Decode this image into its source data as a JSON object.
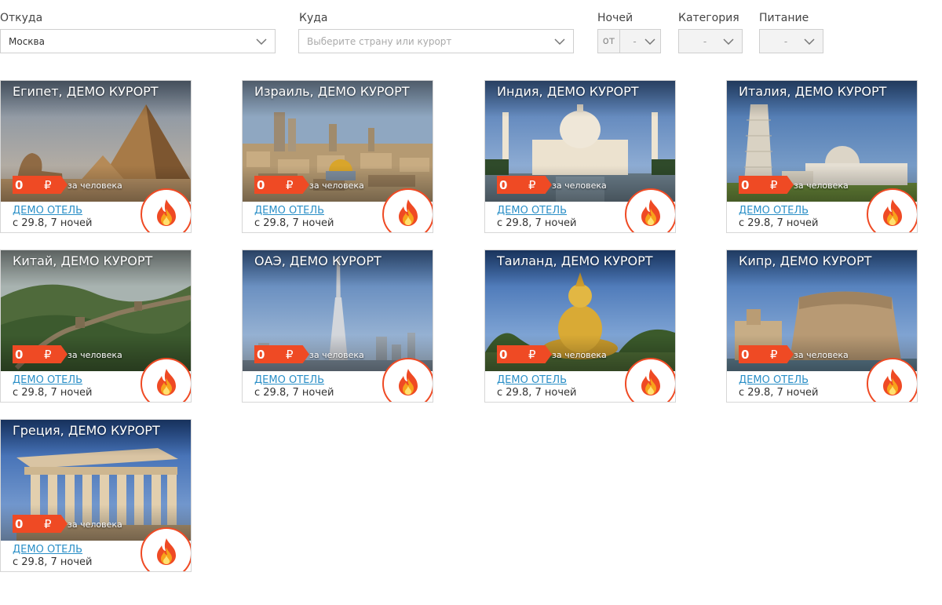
{
  "filters": {
    "from": {
      "label": "Откуда",
      "value": "Москва"
    },
    "to": {
      "label": "Куда",
      "placeholder": "Выберите страну или курорт"
    },
    "nights": {
      "label": "Ночей",
      "prefix": "от",
      "value": "-"
    },
    "category": {
      "label": "Категория",
      "value": "-"
    },
    "meal": {
      "label": "Питание",
      "value": "-"
    }
  },
  "colors": {
    "accent": "#ef4a24",
    "link": "#2a8fc7"
  },
  "tours": [
    {
      "title": "Египет, ДЕМО КУРОРТ",
      "price": "0",
      "currency": "₽",
      "per": "за человека",
      "hotel": "ДЕМО ОТЕЛЬ",
      "dates": "с 29.8, 7 ночей",
      "scene": "egypt",
      "hot_icon": "flame-icon"
    },
    {
      "title": "Израиль, ДЕМО КУРОРТ",
      "price": "0",
      "currency": "₽",
      "per": "за человека",
      "hotel": "ДЕМО ОТЕЛЬ",
      "dates": "с 29.8, 7 ночей",
      "scene": "israel",
      "hot_icon": "flame-icon"
    },
    {
      "title": "Индия, ДЕМО КУРОРТ",
      "price": "0",
      "currency": "₽",
      "per": "за человека",
      "hotel": "ДЕМО ОТЕЛЬ",
      "dates": "с 29.8, 7 ночей",
      "scene": "india",
      "hot_icon": "flame-icon"
    },
    {
      "title": "Италия, ДЕМО КУРОРТ",
      "price": "0",
      "currency": "₽",
      "per": "за человека",
      "hotel": "ДЕМО ОТЕЛЬ",
      "dates": "с 29.8, 7 ночей",
      "scene": "italy",
      "hot_icon": "flame-icon"
    },
    {
      "title": "Китай, ДЕМО КУРОРТ",
      "price": "0",
      "currency": "₽",
      "per": "за человека",
      "hotel": "ДЕМО ОТЕЛЬ",
      "dates": "с 29.8, 7 ночей",
      "scene": "china",
      "hot_icon": "flame-icon"
    },
    {
      "title": "ОАЭ, ДЕМО КУРОРТ",
      "price": "0",
      "currency": "₽",
      "per": "за человека",
      "hotel": "ДЕМО ОТЕЛЬ",
      "dates": "с 29.8, 7 ночей",
      "scene": "uae",
      "hot_icon": "flame-icon"
    },
    {
      "title": "Таиланд, ДЕМО КУРОРТ",
      "price": "0",
      "currency": "₽",
      "per": "за человека",
      "hotel": "ДЕМО ОТЕЛЬ",
      "dates": "с 29.8, 7 ночей",
      "scene": "thailand",
      "hot_icon": "flame-icon"
    },
    {
      "title": "Кипр, ДЕМО КУРОРТ",
      "price": "0",
      "currency": "₽",
      "per": "за человека",
      "hotel": "ДЕМО ОТЕЛЬ",
      "dates": "с 29.8, 7 ночей",
      "scene": "cyprus",
      "hot_icon": "flame-icon"
    },
    {
      "title": "Греция, ДЕМО КУРОРТ",
      "price": "0",
      "currency": "₽",
      "per": "за человека",
      "hotel": "ДЕМО ОТЕЛЬ",
      "dates": "с 29.8, 7 ночей",
      "scene": "greece",
      "hot_icon": "flame-icon"
    }
  ]
}
